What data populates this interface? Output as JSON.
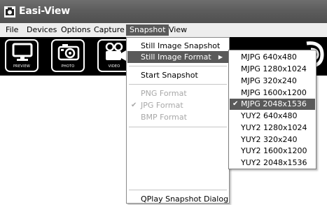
{
  "window": {
    "title": "Easi-View",
    "icon": "easi-view-app-icon"
  },
  "menubar": {
    "items": [
      "File",
      "Devices",
      "Options",
      "Capture",
      "Snapshot",
      "View"
    ],
    "open_item": "Snapshot"
  },
  "toolbar": {
    "buttons": [
      {
        "label": "PREVIEW",
        "icon": "monitor-icon"
      },
      {
        "label": "PHOTO",
        "icon": "camera-icon"
      },
      {
        "label": "VIDEO",
        "icon": "video-camera-icon"
      }
    ]
  },
  "snapshot_menu": {
    "still_image_snapshot": "Still Image Snapshot",
    "still_image_format": "Still Image Format",
    "start_snapshot": "Start Snapshot",
    "png_format": "PNG Format",
    "jpg_format": "JPG Format",
    "bmp_format": "BMP Format",
    "qplay_dialog": "QPlay Snapshot Dialog",
    "checked_format": "JPG Format"
  },
  "format_submenu": {
    "items": [
      "MJPG 640x480",
      "MJPG 1280x1024",
      "MJPG 320x240",
      "MJPG 1600x1200",
      "MJPG 2048x1536",
      "YUY2 640x480",
      "YUY2 1280x1024",
      "YUY2 320x240",
      "YUY2 1600x1200",
      "YUY2 2048x1536"
    ],
    "selected": "MJPG 2048x1536"
  },
  "colors": {
    "titlebar": "#5d5d5d",
    "highlight": "#5a5a5a",
    "toolbar_bg": "#000000",
    "disabled_text": "#a8a8a8"
  }
}
